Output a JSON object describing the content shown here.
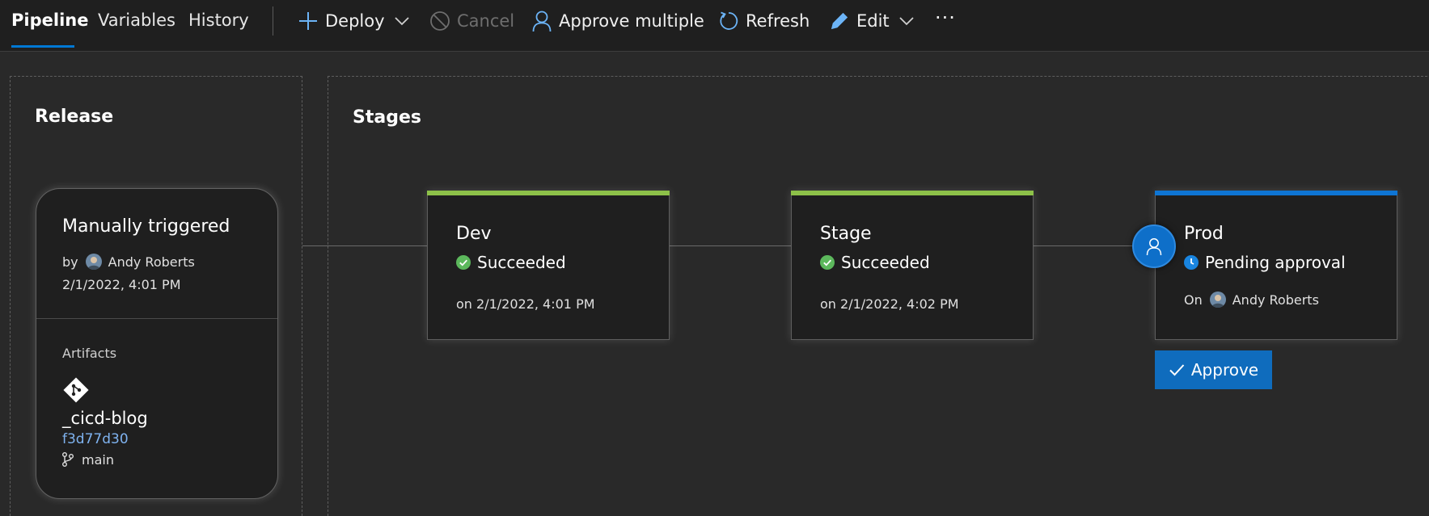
{
  "toolbar": {
    "tabs": [
      {
        "label": "Pipeline",
        "active": true
      },
      {
        "label": "Variables",
        "active": false
      },
      {
        "label": "History",
        "active": false
      }
    ],
    "actions": {
      "deploy": "Deploy",
      "cancel": "Cancel",
      "approve_multiple": "Approve multiple",
      "refresh": "Refresh",
      "edit": "Edit",
      "more": "···"
    }
  },
  "release": {
    "section_title": "Release",
    "trigger": "Manually triggered",
    "by_prefix": "by",
    "user": "Andy Roberts",
    "date": "2/1/2022, 4:01 PM",
    "artifacts_label": "Artifacts",
    "artifact_name": "_cicd-blog",
    "commit": "f3d77d30",
    "branch": "main"
  },
  "stages": {
    "section_title": "Stages",
    "items": [
      {
        "name": "Dev",
        "status": "Succeeded",
        "when": "on 2/1/2022, 4:01 PM"
      },
      {
        "name": "Stage",
        "status": "Succeeded",
        "when": "on 2/1/2022, 4:02 PM"
      },
      {
        "name": "Prod",
        "status": "Pending approval",
        "on_prefix": "On",
        "user": "Andy Roberts"
      }
    ],
    "approve_label": "Approve"
  },
  "colors": {
    "success": "#8dc149",
    "pending": "#0078d4",
    "accent": "#0f6cbd",
    "background": "#292929"
  },
  "icons": [
    "plus-icon",
    "chevron-down-icon",
    "cancel-icon",
    "person-icon",
    "refresh-icon",
    "pencil-icon",
    "more-icon",
    "git-icon",
    "branch-icon",
    "check-circle-icon",
    "clock-icon",
    "check-icon"
  ]
}
